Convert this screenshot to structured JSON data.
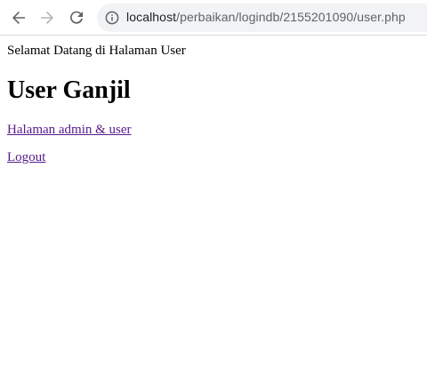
{
  "browser": {
    "url_host": "localhost",
    "url_path": "/perbaikan/logindb/2155201090/user.php"
  },
  "page": {
    "welcome_text": "Selamat Datang di Halaman User",
    "heading": "User Ganjil",
    "links": {
      "admin_user": "Halaman admin & user",
      "logout": "Logout"
    }
  },
  "colors": {
    "visited_link": "#551a8b",
    "omnibox_bg": "#f1f3f4",
    "icon_gray": "#5f6368"
  },
  "icons": {
    "back": "back-arrow-icon",
    "forward": "forward-arrow-icon",
    "reload": "reload-icon",
    "site_info": "info-circle-icon"
  }
}
